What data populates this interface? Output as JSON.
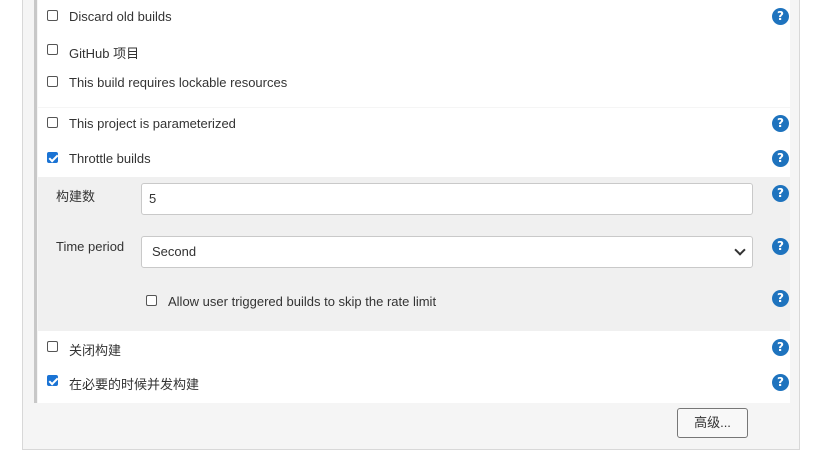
{
  "options": {
    "discard_old_builds": {
      "label": "Discard old builds",
      "checked": false
    },
    "github_project": {
      "label": "GitHub 项目",
      "checked": false
    },
    "lockable_resources": {
      "label": "This build requires lockable resources",
      "checked": false
    },
    "parameterized": {
      "label": "This project is parameterized",
      "checked": false
    },
    "throttle_builds": {
      "label": "Throttle builds",
      "checked": true
    },
    "disable_build": {
      "label": "关闭构建",
      "checked": false
    },
    "concurrent_builds": {
      "label": "在必要的时候并发构建",
      "checked": true
    }
  },
  "throttle": {
    "build_count_label": "构建数",
    "build_count_value": "5",
    "time_period_label": "Time period",
    "time_period_value": "Second",
    "allow_user_label": "Allow user triggered builds to skip the rate limit",
    "allow_user_checked": false
  },
  "help_glyph": "?",
  "advanced_button": "高级...",
  "colors": {
    "accent": "#1a73d4",
    "help": "#1e73be"
  }
}
